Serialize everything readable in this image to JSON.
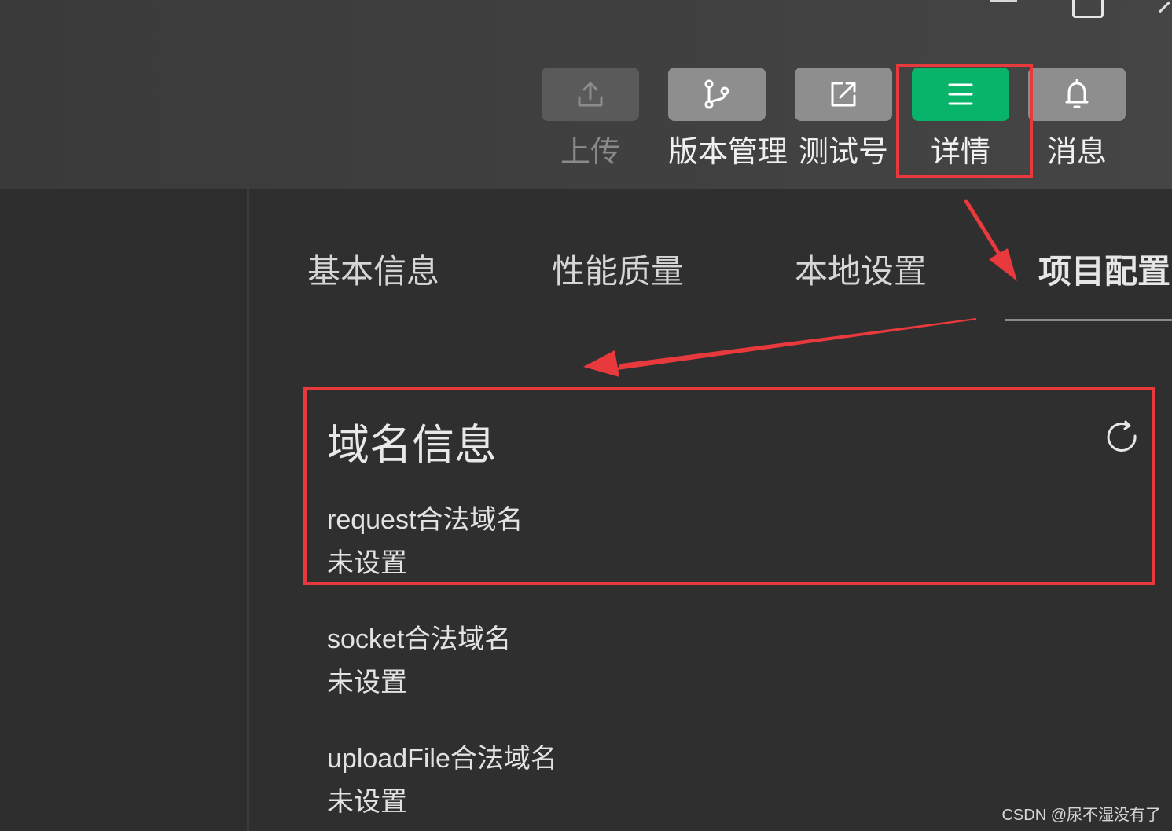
{
  "toolbar": {
    "buttons": [
      {
        "label": "上传",
        "icon": "upload-icon",
        "state": "disabled"
      },
      {
        "label": "版本管理",
        "icon": "branch-icon",
        "state": "normal"
      },
      {
        "label": "测试号",
        "icon": "external-link-icon",
        "state": "normal"
      },
      {
        "label": "详情",
        "icon": "menu-icon",
        "state": "active"
      },
      {
        "label": "消息",
        "icon": "bell-icon",
        "state": "normal"
      }
    ]
  },
  "tabs": [
    {
      "label": "基本信息",
      "active": false
    },
    {
      "label": "性能质量",
      "active": false
    },
    {
      "label": "本地设置",
      "active": false
    },
    {
      "label": "项目配置",
      "active": true
    }
  ],
  "domain_info": {
    "title": "域名信息",
    "refresh_icon": "refresh-icon",
    "items": [
      {
        "label": "request合法域名",
        "value": "未设置"
      },
      {
        "label": "socket合法域名",
        "value": "未设置"
      },
      {
        "label": "uploadFile合法域名",
        "value": "未设置"
      }
    ]
  },
  "colors": {
    "accent_green": "#07b46a",
    "highlight_red": "#e8393c"
  },
  "watermark": "CSDN @尿不湿没有了"
}
